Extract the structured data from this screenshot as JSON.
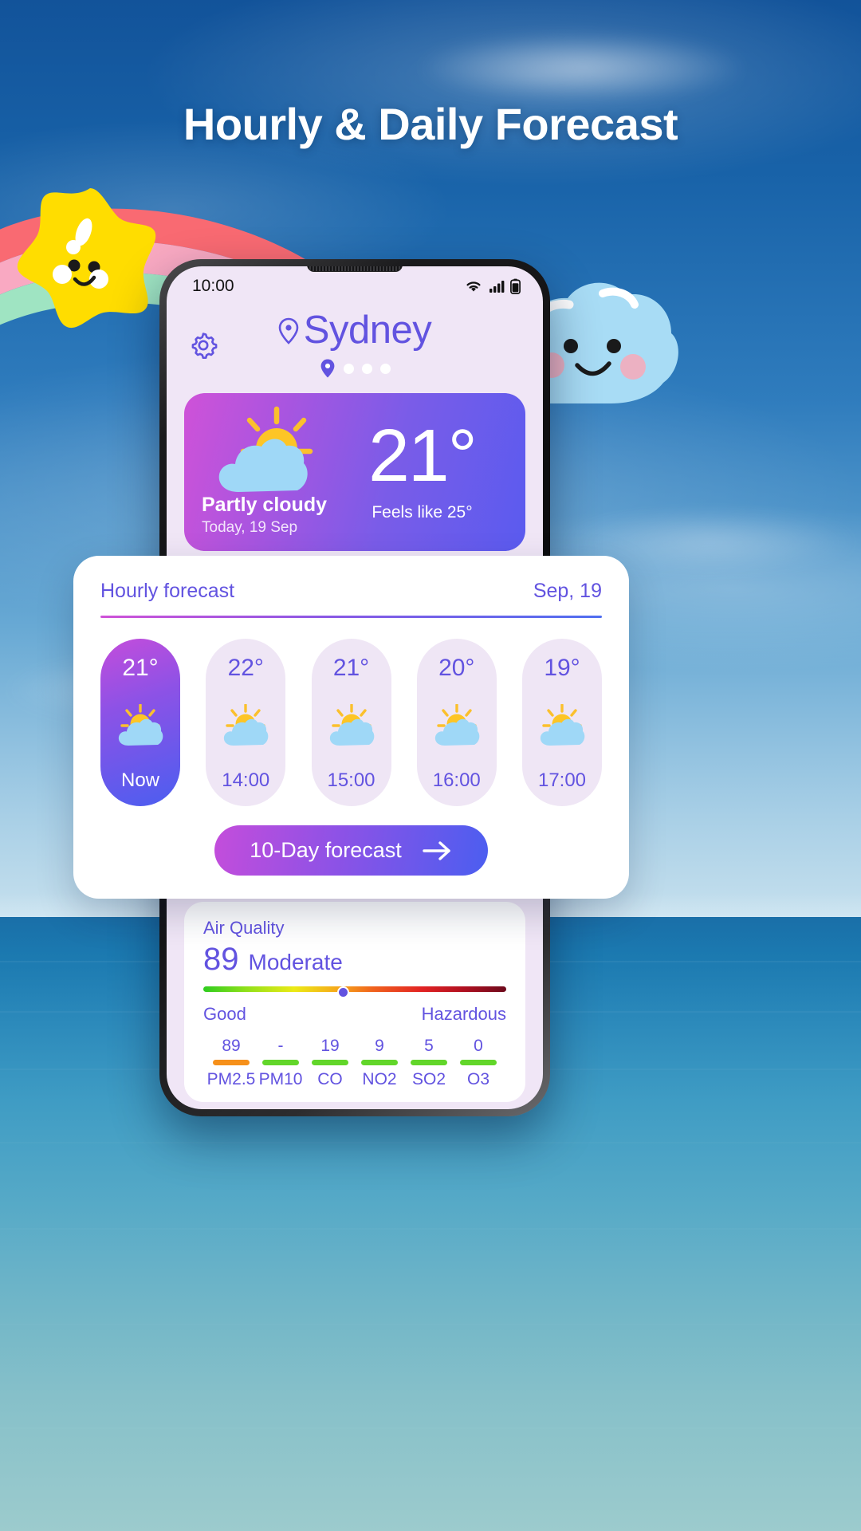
{
  "promo": {
    "headline": "Hourly & Daily Forecast"
  },
  "phone": {
    "statusbar": {
      "time": "10:00",
      "icons": [
        "wifi-icon",
        "cellular-signal-icon",
        "battery-icon"
      ]
    },
    "header": {
      "settings_icon": "gear-icon",
      "location_icon": "location-pin-icon",
      "city": "Sydney",
      "page_dots": 3
    },
    "current": {
      "icon": "partly-cloudy-icon",
      "condition": "Partly cloudy",
      "date": "Today, 19 Sep",
      "temperature": "21°",
      "feels_like": "Feels like 25°"
    },
    "hourly": {
      "title": "Hourly forecast",
      "date": "Sep, 19",
      "items": [
        {
          "temp": "21°",
          "icon": "partly-cloudy-icon",
          "time": "Now",
          "active": true
        },
        {
          "temp": "22°",
          "icon": "partly-cloudy-icon",
          "time": "14:00",
          "active": false
        },
        {
          "temp": "21°",
          "icon": "partly-cloudy-icon",
          "time": "15:00",
          "active": false
        },
        {
          "temp": "20°",
          "icon": "partly-cloudy-icon",
          "time": "16:00",
          "active": false
        },
        {
          "temp": "19°",
          "icon": "partly-cloudy-icon",
          "time": "17:00",
          "active": false
        }
      ],
      "cta_label": "10-Day forecast",
      "cta_icon": "arrow-right-icon"
    },
    "air_quality": {
      "title": "Air Quality",
      "index": "89",
      "category": "Moderate",
      "scale_low": "Good",
      "scale_high": "Hazardous",
      "marker_percent": 46,
      "pollutants": [
        {
          "value": "89",
          "name": "PM2.5",
          "color": "#f6901a"
        },
        {
          "value": "-",
          "name": "PM10",
          "color": "#62d62a"
        },
        {
          "value": "19",
          "name": "CO",
          "color": "#62d62a"
        },
        {
          "value": "9",
          "name": "NO2",
          "color": "#62d62a"
        },
        {
          "value": "5",
          "name": "SO2",
          "color": "#62d62a"
        },
        {
          "value": "0",
          "name": "O3",
          "color": "#62d62a"
        }
      ]
    }
  },
  "decor": {
    "star_icon": "smiling-star-icon",
    "cloud_icon": "smiling-cloud-icon",
    "rainbow_icon": "rainbow-trail-icon"
  },
  "colors": {
    "accent": "#6253e0",
    "gradient_start": "#c44ddb",
    "gradient_end": "#4b5ef0",
    "card_bg": "#ffffff",
    "pill_bg": "#efe6f5",
    "screen_bg": "#f0e6f6"
  }
}
